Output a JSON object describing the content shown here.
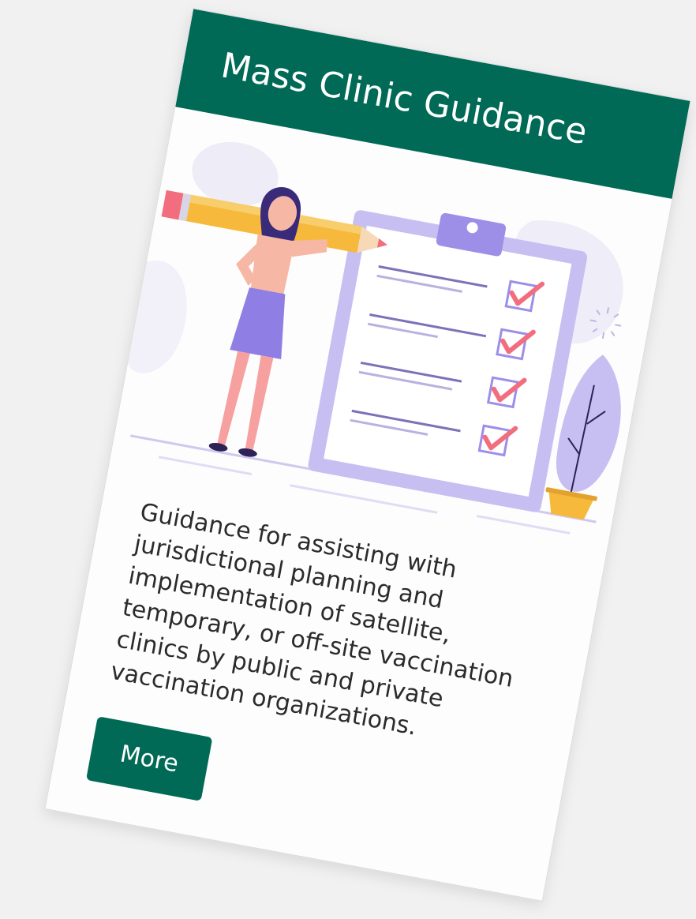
{
  "card": {
    "title": "Mass Clinic Guidance",
    "description": "Guidance for assisting with jurisdictional planning and implementation of satellite, temporary, or off-site vaccination clinics by public and private vaccination organizations.",
    "more_label": "More",
    "illustration": {
      "icons": [
        "woman-with-pencil",
        "clipboard-checklist-icon",
        "check-icon",
        "potted-plant-icon",
        "sparkle-icon"
      ],
      "checklist_items": 4,
      "checked_items": 4
    }
  },
  "colors": {
    "header": "#006a56",
    "button": "#006a56",
    "accent_purple": "#8f7ee3",
    "accent_pink": "#f26d7d",
    "accent_yellow": "#f6b93b"
  }
}
